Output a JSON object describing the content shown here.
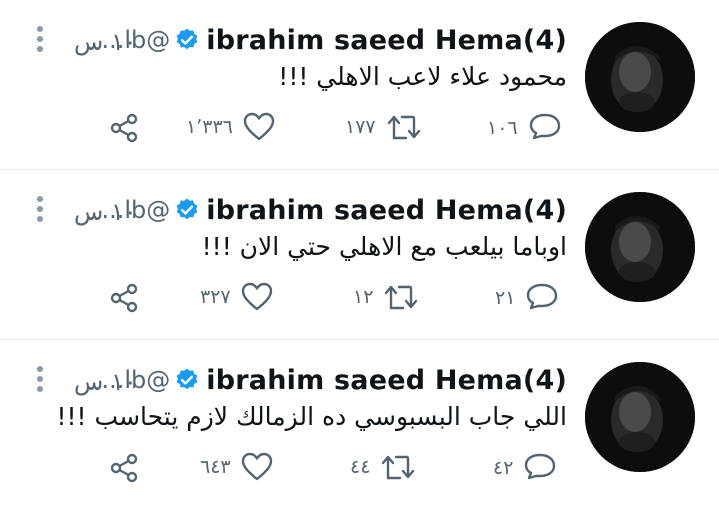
{
  "tweets": [
    {
      "display_name": "ibrahim saeed Hema(4)",
      "handle": "...lb@",
      "time": "١٠ س",
      "text": "محمود علاء لاعب الاهلي !!!",
      "replies": "١٠٦",
      "retweets": "١٧٧",
      "likes": "١٬٣٣٦"
    },
    {
      "display_name": "ibrahim saeed Hema(4)",
      "handle": "...lb@",
      "time": "١٠ س",
      "text": "اوباما بيلعب مع الاهلي حتي الان !!!",
      "replies": "٢١",
      "retweets": "١٢",
      "likes": "٣٢٧"
    },
    {
      "display_name": "ibrahim saeed Hema(4)",
      "handle": "...lb@",
      "time": "١٠ س",
      "text": "اللي جاب البسبوسي ده الزمالك لازم يتحاسب !!!",
      "replies": "٤٢",
      "retweets": "٤٤",
      "likes": "٦٤٣"
    }
  ],
  "colors": {
    "verified": "#1d9bf0",
    "muted": "#536471",
    "divider": "#e6ecf0"
  },
  "icons": [
    "verified-badge-icon",
    "more-options-icon",
    "reply-icon",
    "retweet-icon",
    "like-icon",
    "share-icon"
  ]
}
